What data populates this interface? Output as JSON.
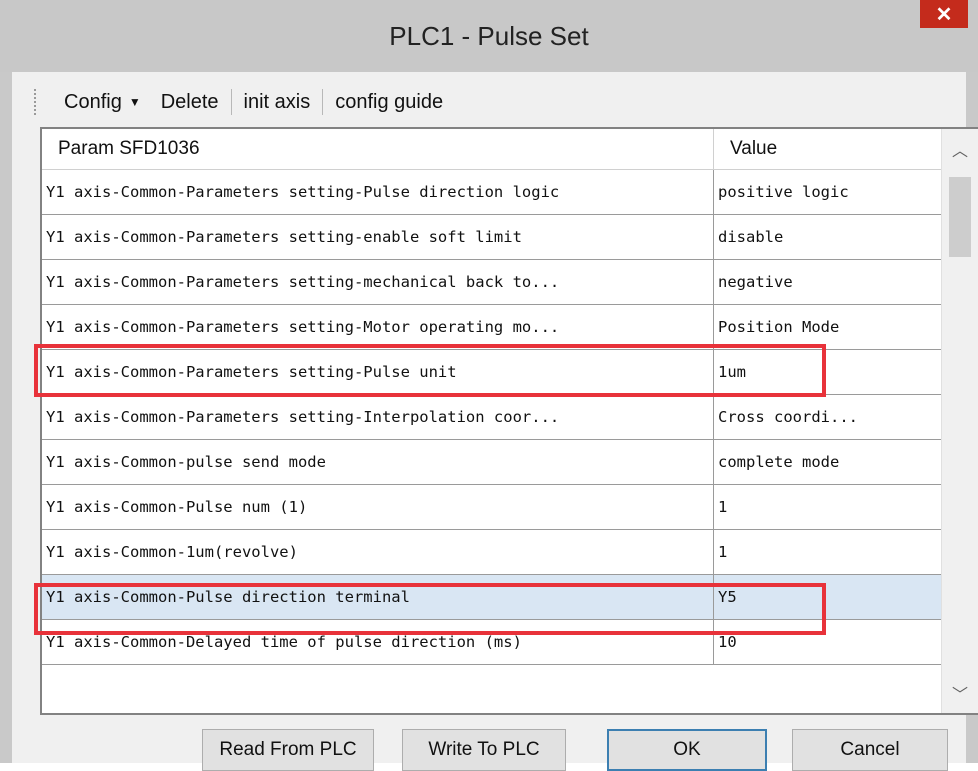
{
  "window": {
    "title": "PLC1 - Pulse  Set",
    "close_label": "✕"
  },
  "toolbar": {
    "config_label": "Config",
    "delete_label": "Delete",
    "init_axis_label": "init axis",
    "config_guide_label": "config guide"
  },
  "grid": {
    "columns": [
      "Param SFD1036",
      "Value"
    ],
    "rows": [
      {
        "param": "Y1 axis-Common-Parameters setting-Pulse direction logic",
        "value": "positive logic"
      },
      {
        "param": "Y1 axis-Common-Parameters setting-enable soft limit",
        "value": "disable"
      },
      {
        "param": "Y1 axis-Common-Parameters setting-mechanical back to...",
        "value": "negative"
      },
      {
        "param": "Y1 axis-Common-Parameters setting-Motor operating mo...",
        "value": "Position Mode"
      },
      {
        "param": "Y1 axis-Common-Parameters setting-Pulse unit",
        "value": "1um"
      },
      {
        "param": "Y1 axis-Common-Parameters setting-Interpolation coor...",
        "value": "Cross coordi..."
      },
      {
        "param": "Y1 axis-Common-pulse send mode",
        "value": "complete mode"
      },
      {
        "param": "Y1 axis-Common-Pulse num (1)",
        "value": "1"
      },
      {
        "param": "Y1 axis-Common-1um(revolve)",
        "value": "1"
      },
      {
        "param": "Y1 axis-Common-Pulse direction terminal",
        "value": "Y5"
      },
      {
        "param": "Y1 axis-Common-Delayed time of pulse direction (ms)",
        "value": "10"
      }
    ],
    "selected_row": 9,
    "highlighted_rows": [
      4,
      9
    ]
  },
  "buttons": {
    "read": "Read From PLC",
    "write": "Write To PLC",
    "ok": "OK",
    "cancel": "Cancel"
  },
  "icons": {
    "scroll_up": "chevron-up-icon",
    "scroll_down": "chevron-down-icon",
    "close": "close-icon"
  },
  "colors": {
    "highlight_border": "#e8323a",
    "selected_row": "#d9e6f3",
    "close_button": "#c42b1c"
  }
}
